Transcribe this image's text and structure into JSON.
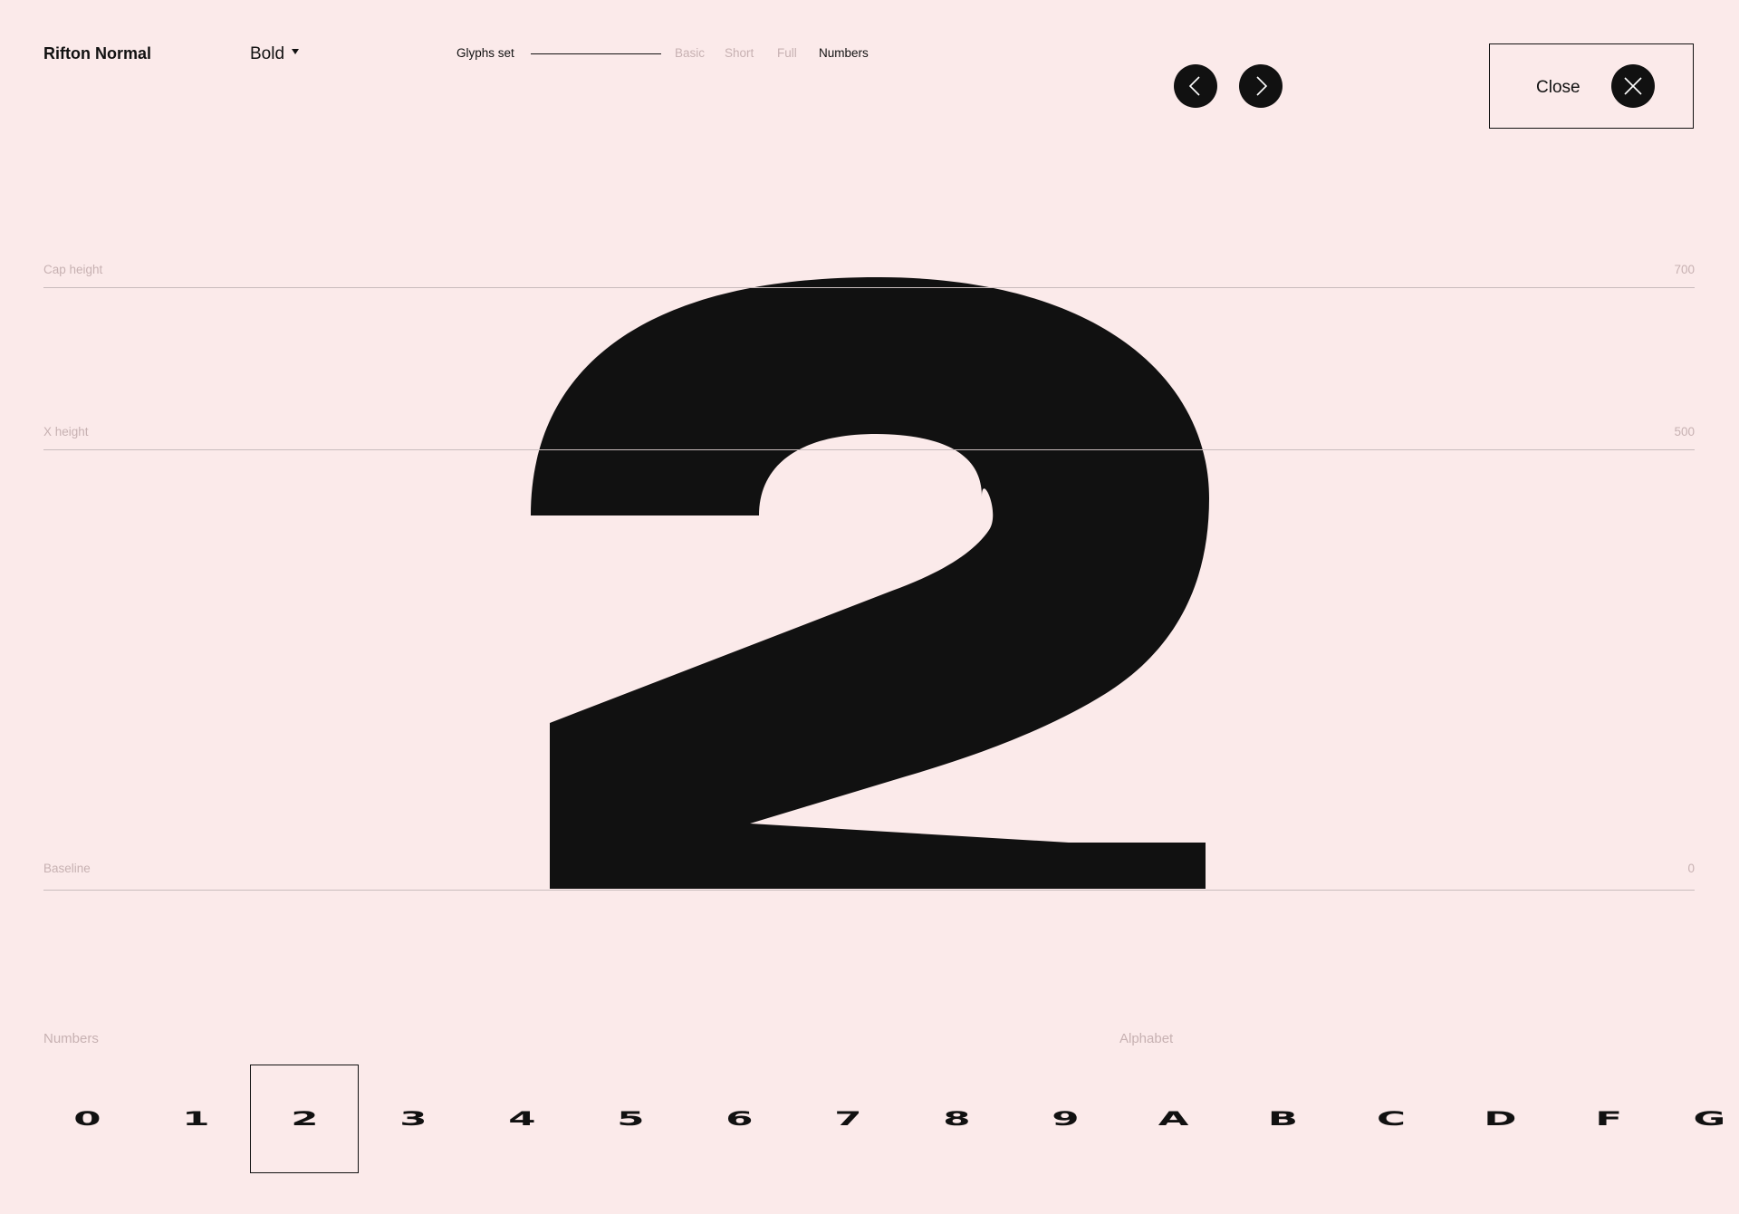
{
  "header": {
    "font_name": "Rifton Normal",
    "weight": "Bold",
    "glyphs_set_label": "Glyphs set",
    "filters": [
      {
        "label": "Basic",
        "active": false
      },
      {
        "label": "Short",
        "active": false
      },
      {
        "label": "Full",
        "active": false
      },
      {
        "label": "Numbers",
        "active": true
      }
    ],
    "prev_icon": "chevron-left-icon",
    "next_icon": "chevron-right-icon",
    "close_label": "Close",
    "close_icon": "close-icon"
  },
  "metrics": {
    "cap_height": {
      "label": "Cap height",
      "value": "700"
    },
    "x_height": {
      "label": "X height",
      "value": "500"
    },
    "baseline": {
      "label": "Baseline",
      "value": "0"
    }
  },
  "preview": {
    "glyph": "2"
  },
  "bottom": {
    "numbers_label": "Numbers",
    "alphabet_label": "Alphabet",
    "glyphs": [
      "0",
      "1",
      "2",
      "3",
      "4",
      "5",
      "6",
      "7",
      "8",
      "9",
      "A",
      "B",
      "C",
      "D",
      "F",
      "G"
    ],
    "selected_glyph": "2"
  },
  "colors": {
    "background": "#fbeaea",
    "ink": "#111111",
    "muted": "#c7b1b2"
  }
}
